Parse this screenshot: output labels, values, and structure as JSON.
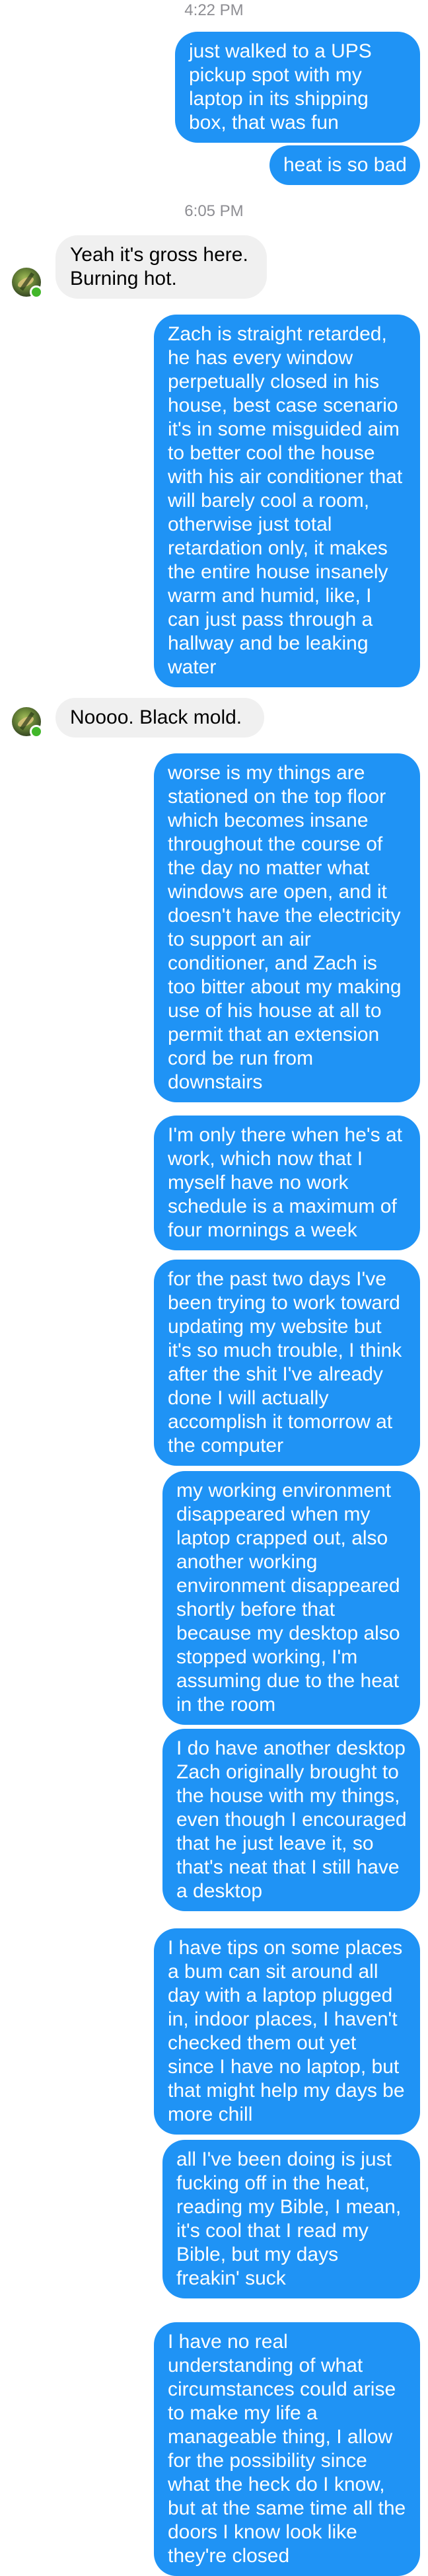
{
  "thread": {
    "timestamps": [
      "4:22 PM",
      "6:05 PM"
    ],
    "messages": [
      {
        "from": "me",
        "text": "just walked to a UPS pickup spot with my laptop in its shipping box, that was fun"
      },
      {
        "from": "me",
        "text": "heat is so bad"
      },
      {
        "from": "them",
        "text": "Yeah it's gross here. Burning hot."
      },
      {
        "from": "me",
        "text": "Zach is straight retarded, he has every window perpetually closed in his house, best case scenario it's in some misguided aim to better cool the house with his air conditioner that will barely cool a room, otherwise just total retardation only, it makes the entire house insanely warm and humid, like, I can just pass through a hallway and be leaking water"
      },
      {
        "from": "them",
        "text": "Noooo. Black mold."
      },
      {
        "from": "me",
        "text": "worse is my things are stationed on the top floor which becomes insane throughout the course of the day no matter what windows are open, and it doesn't have the electricity to support an air conditioner, and Zach is too bitter about my making use of his house at all to permit that an extension cord be run from downstairs"
      },
      {
        "from": "me",
        "text": "I'm only there when he's at work, which now that I myself have no work schedule is a maximum of four mornings a week"
      },
      {
        "from": "me",
        "text": "for the past two days I've been trying to work toward updating my website but it's so much trouble, I think after the shit I've already done I will actually accomplish it tomorrow at the computer"
      },
      {
        "from": "me",
        "text": "my working environment disappeared when my laptop crapped out, also another working environment disappeared shortly before that because my desktop also stopped working, I'm assuming due to the heat in the room"
      },
      {
        "from": "me",
        "text": "I do have another desktop Zach originally brought to the house with my things, even though I encouraged that he just leave it, so that's neat that I still have a desktop"
      },
      {
        "from": "me",
        "text": "I have tips on some places a bum can sit around all day with a laptop plugged in, indoor places, I haven't checked them out yet since I have no laptop, but that might help my days be more chill"
      },
      {
        "from": "me",
        "text": "all I've been doing is just fucking off in the heat, reading my Bible, I mean, it's cool that I read my Bible, but my days freakin' suck"
      },
      {
        "from": "me",
        "text": "I have no real understanding of what circumstances could arise to make my life a manageable thing, I allow for the possibility since what the heck do I know, but at the same time all the doors I know look like they're closed"
      }
    ]
  },
  "colors": {
    "outgoing_bubble": "#1f93f5",
    "incoming_bubble": "#f0f0f0",
    "timestamp_text": "#8e8e93",
    "online_dot": "#42b72a"
  },
  "icons": {
    "avatar": "contact-avatar",
    "online": "online-status-dot"
  }
}
